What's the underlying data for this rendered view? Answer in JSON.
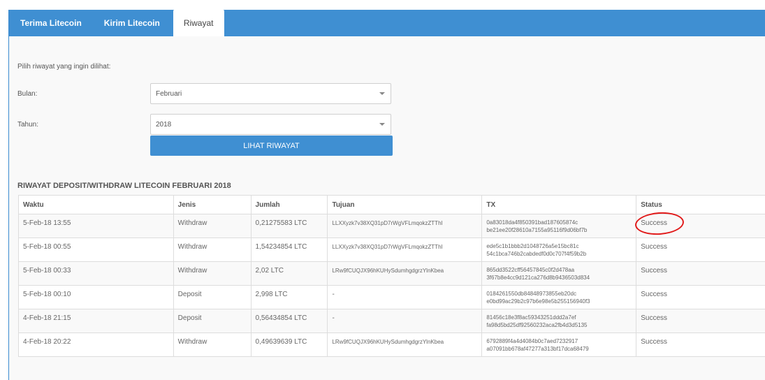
{
  "tabs": [
    {
      "label": "Terima Litecoin",
      "active": false
    },
    {
      "label": "Kirim Litecoin",
      "active": false
    },
    {
      "label": "Riwayat",
      "active": true
    }
  ],
  "form": {
    "prompt": "Pilih riwayat yang ingin dilihat:",
    "month_label": "Bulan:",
    "month_value": "Februari",
    "year_label": "Tahun:",
    "year_value": "2018",
    "button_label": "LIHAT RIWAYAT"
  },
  "history": {
    "title": "RIWAYAT DEPOSIT/WITHDRAW LITECOIN FEBRUARI 2018",
    "columns": [
      "Waktu",
      "Jenis",
      "Jumlah",
      "Tujuan",
      "TX",
      "Status"
    ],
    "rows": [
      {
        "time": "5-Feb-18 13:55",
        "type": "Withdraw",
        "amount": "0,21275583 LTC",
        "dest": "LLXXyzk7v38XQ31pD7rWgVFLmqokzZTThl",
        "tx1": "0a83018da4f850391bad187605874c",
        "tx2": "be21ee20f28610a7155a95116f9d06bf7b",
        "status": "Success"
      },
      {
        "time": "5-Feb-18 00:55",
        "type": "Withdraw",
        "amount": "1,54234854 LTC",
        "dest": "LLXXyzk7v38XQ31pD7rWgVFLmqokzZTThl",
        "tx1": "ede5c1b1bbb2d1048726a5e15bc81c",
        "tx2": "54c1bca746b2cabdedf0d0c707f4f59b2b",
        "status": "Success"
      },
      {
        "time": "5-Feb-18 00:33",
        "type": "Withdraw",
        "amount": "2,02 LTC",
        "dest": "LRw9fCUQJX96hKUHySdumhgdgrzYlnKbea",
        "tx1": "865dd3522cff56457845c0f2d478aa",
        "tx2": "3f67b8e4cc9d121ca276d8b9436503d834",
        "status": "Success"
      },
      {
        "time": "5-Feb-18 00:10",
        "type": "Deposit",
        "amount": "2,998 LTC",
        "dest": "-",
        "tx1": "0184261550db84848973855eb20dc",
        "tx2": "e0bd99ac29b2c97b6e98e5b255156940f3",
        "status": "Success"
      },
      {
        "time": "4-Feb-18 21:15",
        "type": "Deposit",
        "amount": "0,56434854 LTC",
        "dest": "-",
        "tx1": "81456c18e3f8ac59343251ddd2a7ef",
        "tx2": "fa98d5bd25df92560232aca2fb4d3d5135",
        "status": "Success"
      },
      {
        "time": "4-Feb-18 20:22",
        "type": "Withdraw",
        "amount": "0,49639639 LTC",
        "dest": "LRw9fCUQJX96hKUHySdumhgdgrzYlnKbea",
        "tx1": "6792889f4a4d4084b0c7aed7232917",
        "tx2": "a07091bb678af47277a313bf17dca68479",
        "status": "Success"
      }
    ]
  },
  "colors": {
    "accent": "#3f8fd2",
    "annotation": "#e11a1a"
  }
}
